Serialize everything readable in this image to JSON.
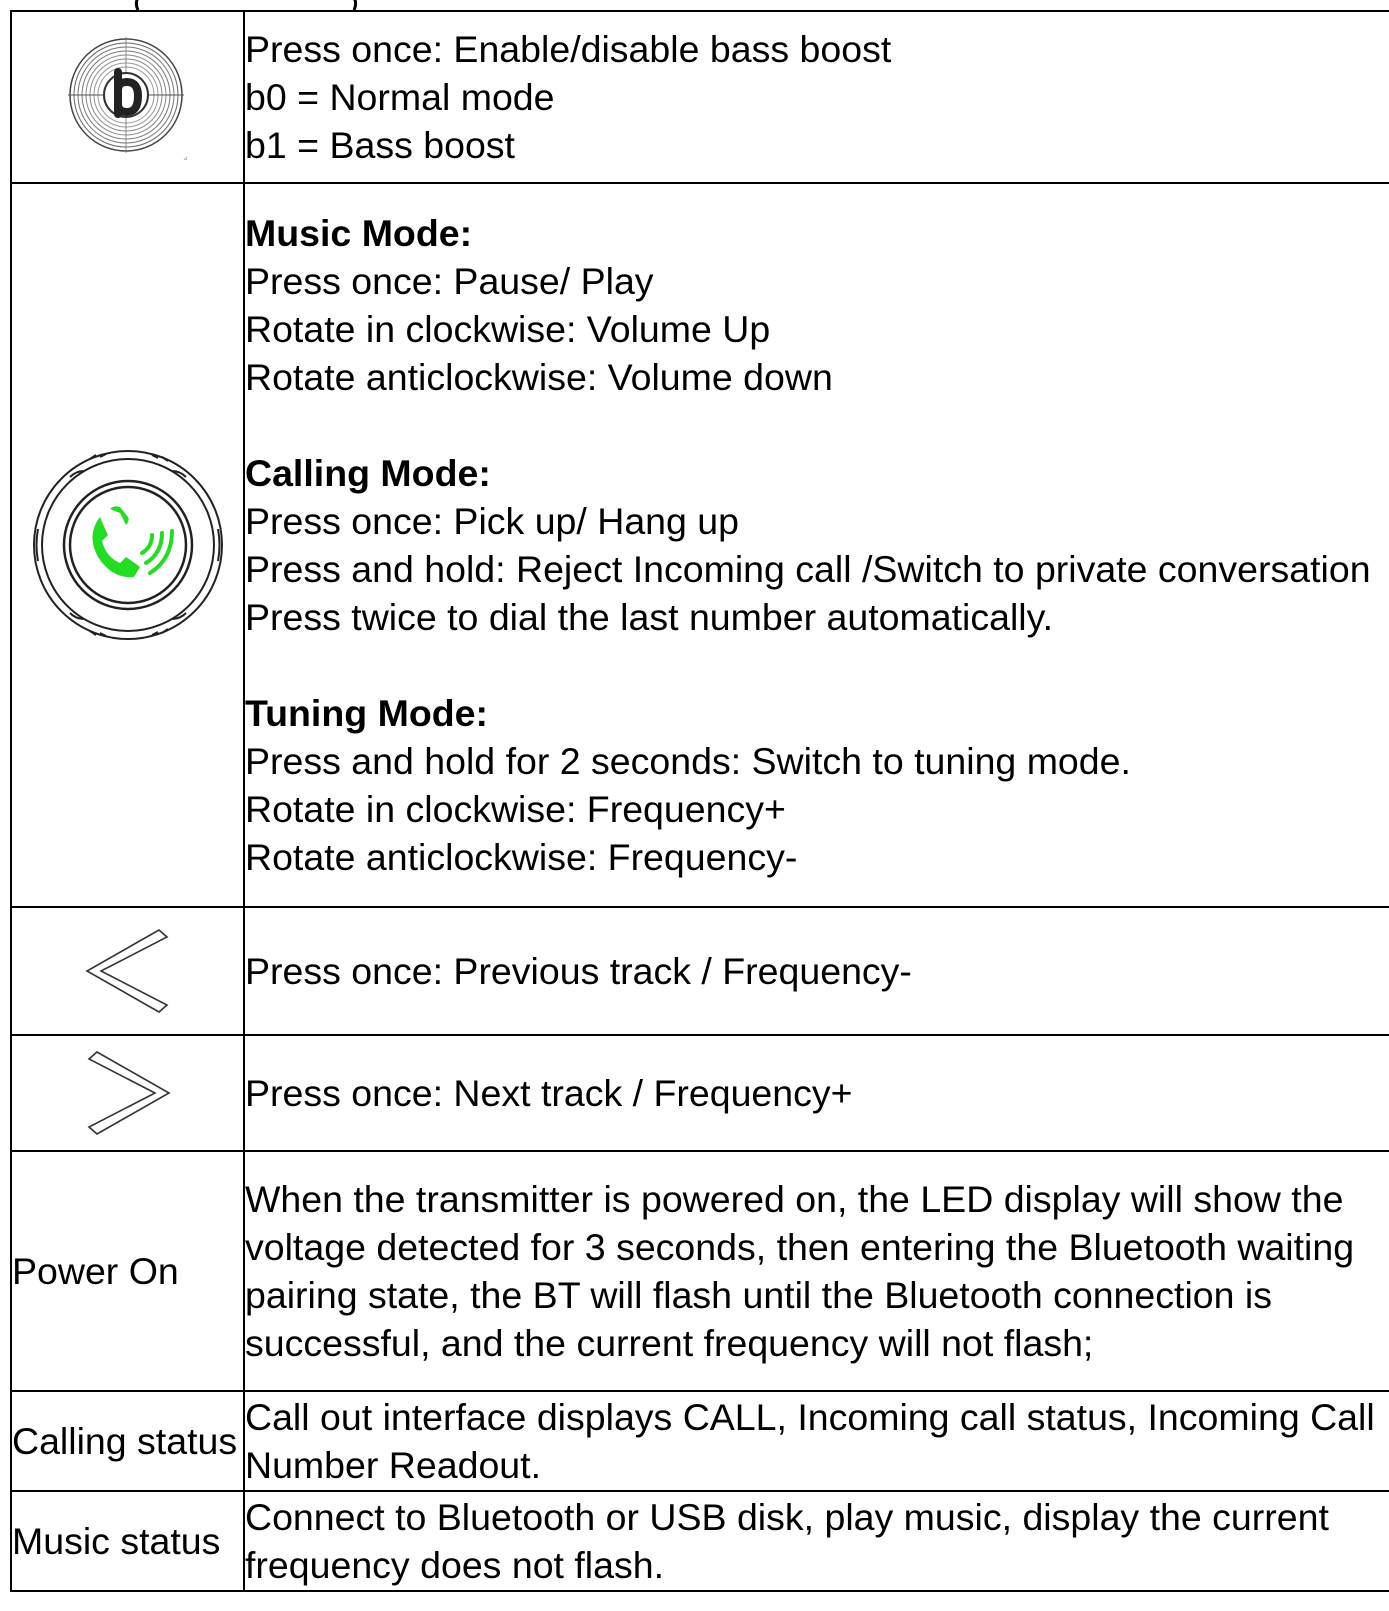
{
  "rows": [
    {
      "icon": "bass-boost-knob-icon",
      "lines": [
        "Press once: Enable/disable bass boost",
        "b0 = Normal mode",
        "b1 = Bass boost"
      ]
    },
    {
      "icon": "phone-knob-icon",
      "music_heading": "Music Mode:",
      "music_lines": [
        "Press once: Pause/ Play",
        "Rotate in clockwise: Volume Up",
        "Rotate anticlockwise: Volume down"
      ],
      "calling_heading": "Calling Mode:",
      "calling_lines": [
        "Press once: Pick up/ Hang up",
        "Press and hold: Reject Incoming call /Switch to private conversation",
        "Press twice to dial the last number automatically."
      ],
      "tuning_heading": "Tuning Mode:",
      "tuning_lines": [
        "Press and hold for 2 seconds: Switch to tuning mode.",
        "Rotate in clockwise: Frequency+",
        "Rotate anticlockwise: Frequency-"
      ]
    },
    {
      "icon": "previous-chevron-icon",
      "text": "Press once: Previous track / Frequency-"
    },
    {
      "icon": "next-chevron-icon",
      "text": "Press once: Next track / Frequency+"
    },
    {
      "label": "Power On",
      "text": "When the transmitter is powered on, the LED display will show the voltage detected for 3 seconds, then entering the Bluetooth waiting pairing state, the BT will flash until the Bluetooth connection is successful, and the current frequency will not flash;"
    },
    {
      "label": "Calling status",
      "text": "Call out interface displays CALL, Incoming call status, Incoming Call Number Readout."
    },
    {
      "label": "Music status",
      "text": "Connect to Bluetooth or USB disk, play music, display the current frequency does not flash."
    }
  ],
  "colors": {
    "phone_green": "#22dd22",
    "border": "#000000"
  }
}
